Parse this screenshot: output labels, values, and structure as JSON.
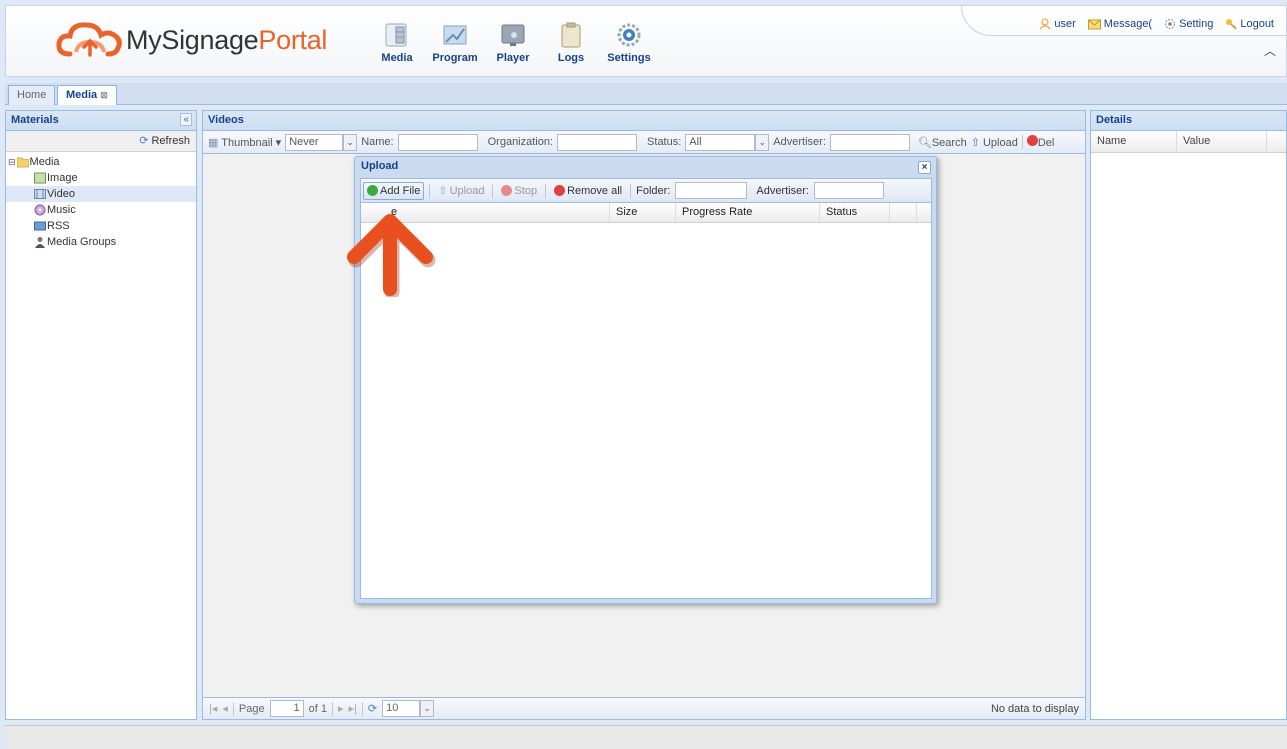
{
  "header": {
    "logo_text_part1": "MySignage",
    "logo_text_part2": "Portal",
    "nav": [
      {
        "label": "Media",
        "icon": "media-icon"
      },
      {
        "label": "Program",
        "icon": "program-icon"
      },
      {
        "label": "Player",
        "icon": "player-icon"
      },
      {
        "label": "Logs",
        "icon": "logs-icon"
      },
      {
        "label": "Settings",
        "icon": "settings-icon"
      }
    ],
    "user_label": "user",
    "message_label": "Message(",
    "setting_label": "Setting",
    "logout_label": "Logout"
  },
  "tabs": [
    {
      "label": "Home",
      "active": false
    },
    {
      "label": "Media",
      "active": true
    }
  ],
  "materials": {
    "title": "Materials",
    "refresh_label": "Refresh",
    "tree": [
      {
        "label": "Media",
        "icon": "folder-icon"
      },
      {
        "label": "Image",
        "icon": "image-icon"
      },
      {
        "label": "Video",
        "icon": "video-icon",
        "selected": true
      },
      {
        "label": "Music",
        "icon": "music-icon"
      },
      {
        "label": "RSS",
        "icon": "rss-icon"
      },
      {
        "label": "Media Groups",
        "icon": "media-groups-icon"
      }
    ]
  },
  "videos": {
    "title": "Videos",
    "view_label": "Thumbnail",
    "never_value": "Never",
    "name_label": "Name:",
    "organization_label": "Organization:",
    "status_label": "Status:",
    "status_value": "All",
    "advertiser_label": "Advertiser:",
    "search_label": "Search",
    "upload_label": "Upload",
    "delete_label": "Del",
    "paging": {
      "page_label": "Page",
      "page_value": "1",
      "of_label": "of 1",
      "page_size": "10",
      "empty_text": "No data to display"
    }
  },
  "details": {
    "title": "Details",
    "col_name": "Name",
    "col_value": "Value"
  },
  "upload_dialog": {
    "title": "Upload",
    "close_glyph": "×",
    "add_file_label": "Add File",
    "upload_label": "Upload",
    "stop_label": "Stop",
    "remove_all_label": "Remove all",
    "folder_label": "Folder:",
    "advertiser_label": "Advertiser:",
    "columns": [
      "e",
      "Size",
      "Progress Rate",
      "Status"
    ]
  },
  "colors": {
    "brand_orange": "#e8642a",
    "header_blue": "#15428b",
    "arrow_orange": "#e8501f"
  }
}
